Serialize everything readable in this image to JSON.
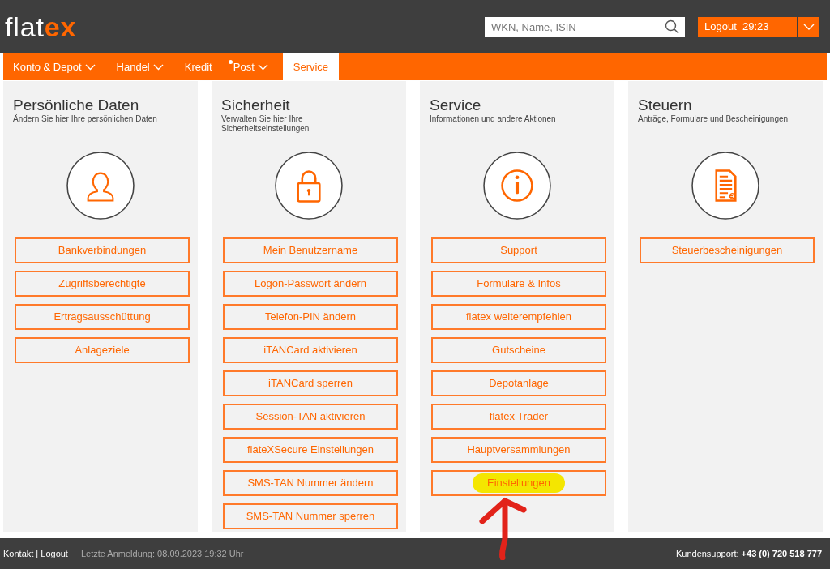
{
  "header": {
    "logo": {
      "text": "flat",
      "accent": "ex"
    },
    "search": {
      "placeholder": "WKN, Name, ISIN"
    },
    "logout": {
      "label": "Logout",
      "timer": "29:23"
    }
  },
  "nav": [
    {
      "label": "Konto & Depot",
      "dropdown": true,
      "dot": false,
      "selected": false
    },
    {
      "label": "Handel",
      "dropdown": true,
      "dot": false,
      "selected": false
    },
    {
      "label": "Kredit",
      "dropdown": false,
      "dot": false,
      "selected": false
    },
    {
      "label": "Post",
      "dropdown": true,
      "dot": true,
      "selected": false
    },
    {
      "label": "Service",
      "dropdown": false,
      "dot": false,
      "selected": true
    }
  ],
  "cards": [
    {
      "title": "Persönliche Daten",
      "subtitle": "Ändern Sie hier Ihre persönlichen Daten",
      "kind": "person",
      "arrow": false,
      "buttons": [
        {
          "label": "Bankverbindungen",
          "highlighted": false
        },
        {
          "label": "Zugriffsberechtigte",
          "highlighted": false
        },
        {
          "label": "Ertragsausschüttung",
          "highlighted": false
        },
        {
          "label": "Anlageziele",
          "highlighted": false
        }
      ]
    },
    {
      "title": "Sicherheit",
      "subtitle": "Verwalten Sie hier Ihre Sicherheitseinstellungen",
      "kind": "lock",
      "arrow": false,
      "buttons": [
        {
          "label": "Mein Benutzername",
          "highlighted": false
        },
        {
          "label": "Logon-Passwort ändern",
          "highlighted": false
        },
        {
          "label": "Telefon-PIN ändern",
          "highlighted": false
        },
        {
          "label": "iTANCard aktivieren",
          "highlighted": false
        },
        {
          "label": "iTANCard sperren",
          "highlighted": false
        },
        {
          "label": "Session-TAN aktivieren",
          "highlighted": false
        },
        {
          "label": "flateXSecure Einstellungen",
          "highlighted": false
        },
        {
          "label": "SMS-TAN Nummer ändern",
          "highlighted": false
        },
        {
          "label": "SMS-TAN Nummer sperren",
          "highlighted": false
        }
      ]
    },
    {
      "title": "Service",
      "subtitle": "Informationen und andere Aktionen",
      "kind": "info",
      "arrow": true,
      "buttons": [
        {
          "label": "Support",
          "highlighted": false
        },
        {
          "label": "Formulare & Infos",
          "highlighted": false
        },
        {
          "label": "flatex weiterempfehlen",
          "highlighted": false
        },
        {
          "label": "Gutscheine",
          "highlighted": false
        },
        {
          "label": "Depotanlage",
          "highlighted": false
        },
        {
          "label": "flatex Trader",
          "highlighted": false
        },
        {
          "label": "Hauptversammlungen",
          "highlighted": false
        },
        {
          "label": "Einstellungen",
          "highlighted": true
        }
      ]
    },
    {
      "title": "Steuern",
      "subtitle": "Anträge, Formulare und Bescheinigungen",
      "kind": "document",
      "arrow": false,
      "buttons": [
        {
          "label": "Steuerbescheinigungen",
          "highlighted": false
        }
      ]
    }
  ],
  "footer": {
    "links": "Kontakt | Logout",
    "last_login": "Letzte Anmeldung: 08.09.2023 19:32 Uhr",
    "support_label": "Kundensupport:",
    "support_phone": "+43 (0) 720 518 777"
  }
}
